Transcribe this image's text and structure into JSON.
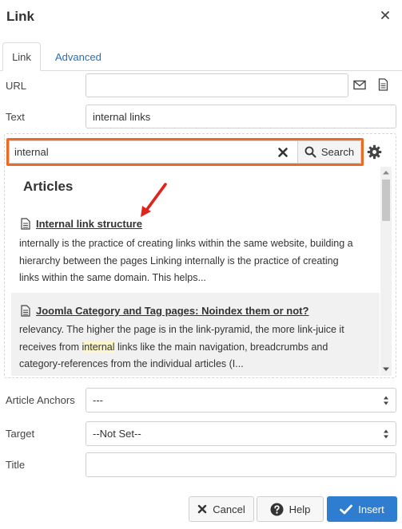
{
  "dialog": {
    "title": "Link"
  },
  "tabs": [
    {
      "label": "Link",
      "active": true
    },
    {
      "label": "Advanced",
      "active": false
    }
  ],
  "fields": {
    "url": {
      "label": "URL",
      "value": ""
    },
    "text": {
      "label": "Text",
      "value": "internal links"
    },
    "article_anchors": {
      "label": "Article Anchors",
      "value": "---"
    },
    "target": {
      "label": "Target",
      "value": "--Not Set--"
    },
    "title": {
      "label": "Title",
      "value": ""
    }
  },
  "search": {
    "query": "internal",
    "button_label": "Search",
    "highlight_color": "#ec6a23"
  },
  "results": {
    "section_title": "Articles",
    "items": [
      {
        "title": "Internal link structure",
        "lines": [
          "internally is the practice of creating links within the same website, building a",
          "hierarchy between the pages Linking internally is the practice of creating",
          "links within the same domain. This helps..."
        ]
      },
      {
        "title": "Joomla Category and Tag pages: Noindex them or not?",
        "lines": [
          "relevancy. The higher the page is in the link-pyramid, the more link-juice it",
          "receives from ",
          "internal",
          " links like the main navigation, breadcrumbs and",
          "category-references from the individual articles (I..."
        ]
      }
    ]
  },
  "footer": {
    "cancel_label": "Cancel",
    "help_label": "Help",
    "insert_label": "Insert",
    "insert_color": "#2f7dd1"
  }
}
